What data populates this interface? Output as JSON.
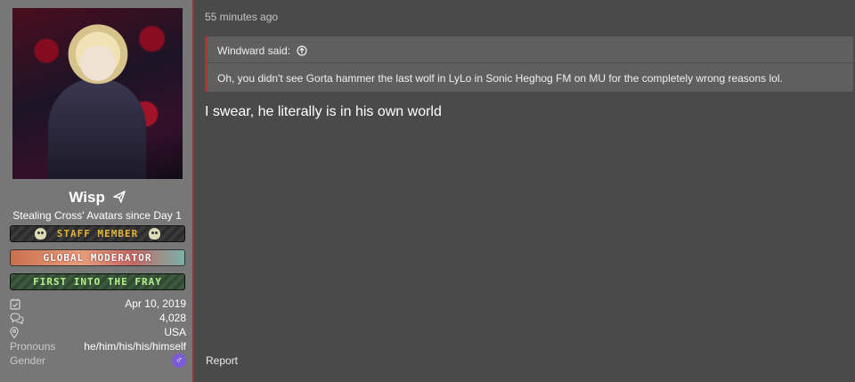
{
  "user": {
    "name": "Wisp",
    "title": "Stealing Cross' Avatars since Day 1",
    "banners": [
      "STAFF MEMBER",
      "GLOBAL MODERATOR",
      "FIRST INTO THE FRAY"
    ],
    "stats": {
      "joined": "Apr 10, 2019",
      "messages": "4,028",
      "location": "USA",
      "pronouns_label": "Pronouns",
      "pronouns": "he/him/his/his/himself",
      "gender_label": "Gender",
      "gender_symbol": "♂"
    }
  },
  "post": {
    "time": "55 minutes ago",
    "quote": {
      "author": "Windward said:",
      "text": "Oh, you didn't see Gorta hammer the last wolf in LyLo in Sonic Heghog FM on MU for the completely wrong reasons lol."
    },
    "body": "I swear, he literally is in his own world",
    "report_label": "Report"
  },
  "colors": {
    "accent": "#a33b3b",
    "gender_badge": "#7c5bd6"
  }
}
